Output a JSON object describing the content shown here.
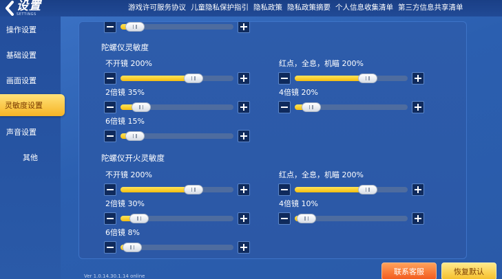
{
  "header": {
    "back_title": "设置",
    "back_subtitle": "SETTINGS",
    "links": [
      "游戏许可服务协议",
      "儿童隐私保护指引",
      "隐私政策",
      "隐私政策摘要",
      "个人信息收集清单",
      "第三方信息共享清单"
    ]
  },
  "sidebar": {
    "items": [
      {
        "label": "操作设置",
        "active": false
      },
      {
        "label": "基础设置",
        "active": false
      },
      {
        "label": "画面设置",
        "active": false
      },
      {
        "label": "灵敏度设置",
        "active": true
      },
      {
        "label": "声音设置",
        "active": false
      },
      {
        "label": "其他",
        "active": false
      }
    ]
  },
  "panel": {
    "gyro": {
      "title": "陀螺仪灵敏度",
      "sliders": [
        {
          "label": "不开镜 200%",
          "fill": 0.56
        },
        {
          "label": "红点，全息，机瞄 200%",
          "fill": 0.56
        },
        {
          "label": "2倍镜 35%",
          "fill": 0.1
        },
        {
          "label": "4倍镜 20%",
          "fill": 0.06
        },
        {
          "label": "6倍镜 15%",
          "fill": 0.04
        }
      ]
    },
    "gyro_fire": {
      "title": "陀螺仪开火灵敏度",
      "sliders": [
        {
          "label": "不开镜 200%",
          "fill": 0.56
        },
        {
          "label": "红点，全息，机瞄 200%",
          "fill": 0.56
        },
        {
          "label": "2倍镜 30%",
          "fill": 0.08
        },
        {
          "label": "4倍镜 10%",
          "fill": 0.02
        },
        {
          "label": "6倍镜 8%",
          "fill": 0.02
        }
      ]
    },
    "top_partial": {
      "fill": 0.04
    }
  },
  "footer": {
    "version": "Ver 1.0.14.30.1.14 online",
    "contact_label": "联系客服",
    "reset_label": "恢复默认"
  },
  "colors": {
    "accent_yellow": "#f6b424",
    "panel_blue": "#2c58a6",
    "button_dark": "#0f2a5c"
  }
}
